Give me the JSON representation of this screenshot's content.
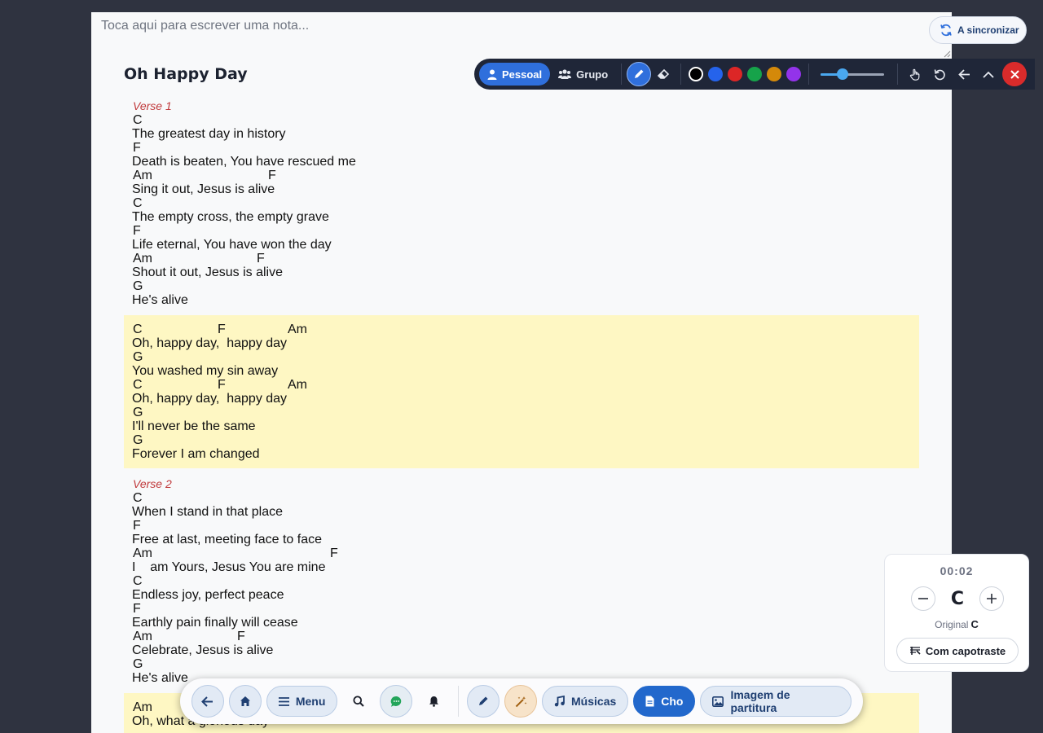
{
  "note": {
    "placeholder": "Toca aqui para escrever uma nota..."
  },
  "song": {
    "title": "Oh Happy Day",
    "sections": [
      {
        "label": "Verse 1",
        "type": "verse",
        "lines": [
          {
            "chords": [
              {
                "pos": 0,
                "name": "C"
              }
            ],
            "lyric": "The greatest day in history"
          },
          {
            "chords": [
              {
                "pos": 0,
                "name": "F"
              }
            ],
            "lyric": "Death is beaten, You have rescued me"
          },
          {
            "chords": [
              {
                "pos": 0,
                "name": "Am"
              },
              {
                "pos": 166,
                "name": "F"
              }
            ],
            "lyric": "Sing it out, Jesus is alive"
          },
          {
            "chords": [
              {
                "pos": 0,
                "name": "C"
              }
            ],
            "lyric": "The empty cross, the empty grave"
          },
          {
            "chords": [
              {
                "pos": 0,
                "name": "F"
              }
            ],
            "lyric": "Life eternal, You have won the day"
          },
          {
            "chords": [
              {
                "pos": 0,
                "name": "Am"
              },
              {
                "pos": 152,
                "name": "F"
              }
            ],
            "lyric": "Shout it out, Jesus is alive"
          },
          {
            "chords": [
              {
                "pos": 0,
                "name": "G"
              }
            ],
            "lyric": "He's alive"
          }
        ]
      },
      {
        "label": "",
        "type": "chorus",
        "lines": [
          {
            "chords": [
              {
                "pos": 0,
                "name": "C"
              },
              {
                "pos": 104,
                "name": "F"
              },
              {
                "pos": 190,
                "name": "Am"
              }
            ],
            "lyric": "Oh, happy day,  happy day"
          },
          {
            "chords": [
              {
                "pos": 0,
                "name": "G"
              }
            ],
            "lyric": "You washed my sin away"
          },
          {
            "chords": [
              {
                "pos": 0,
                "name": "C"
              },
              {
                "pos": 104,
                "name": "F"
              },
              {
                "pos": 190,
                "name": "Am"
              }
            ],
            "lyric": "Oh, happy day,  happy day"
          },
          {
            "chords": [
              {
                "pos": 0,
                "name": "G"
              }
            ],
            "lyric": "I'll never be the same"
          },
          {
            "chords": [
              {
                "pos": 0,
                "name": "G"
              }
            ],
            "lyric": "Forever I am changed"
          }
        ]
      },
      {
        "label": "Verse 2",
        "type": "verse",
        "lines": [
          {
            "chords": [
              {
                "pos": 0,
                "name": "C"
              }
            ],
            "lyric": "When I stand in that place"
          },
          {
            "chords": [
              {
                "pos": 0,
                "name": "F"
              }
            ],
            "lyric": "Free at last, meeting face to face"
          },
          {
            "chords": [
              {
                "pos": 0,
                "name": "Am"
              },
              {
                "pos": 242,
                "name": "F"
              }
            ],
            "lyric": "I    am Yours, Jesus You are mine"
          },
          {
            "chords": [
              {
                "pos": 0,
                "name": "C"
              }
            ],
            "lyric": "Endless joy, perfect peace"
          },
          {
            "chords": [
              {
                "pos": 0,
                "name": "F"
              }
            ],
            "lyric": "Earthly pain finally will cease"
          },
          {
            "chords": [
              {
                "pos": 0,
                "name": "Am"
              },
              {
                "pos": 128,
                "name": "F"
              }
            ],
            "lyric": "Celebrate, Jesus is alive"
          },
          {
            "chords": [
              {
                "pos": 0,
                "name": "G"
              }
            ],
            "lyric": "He's alive"
          }
        ]
      },
      {
        "label": "",
        "type": "chorus",
        "lines": [
          {
            "chords": [
              {
                "pos": 0,
                "name": "Am"
              }
            ],
            "lyric": "Oh, what a glorious day"
          }
        ]
      }
    ]
  },
  "toolbar": {
    "pessoal_label": "Pessoal",
    "grupo_label": "Grupo",
    "colors": [
      "#000000",
      "#2563eb",
      "#dc2626",
      "#16a34a",
      "#d4890a",
      "#9333ea"
    ],
    "selected_color": "#000000",
    "stroke_level_pct": 35
  },
  "sync": {
    "label": "A sincronizar"
  },
  "key_panel": {
    "timer": "00:02",
    "key": "C",
    "original_label": "Original",
    "original_key": "C",
    "capo_label": "Com capotraste"
  },
  "bottom_nav": {
    "menu_label": "Menu",
    "musicas_label": "Músicas",
    "cho_label": "Cho",
    "partitura_label": "Imagem de partitura"
  }
}
